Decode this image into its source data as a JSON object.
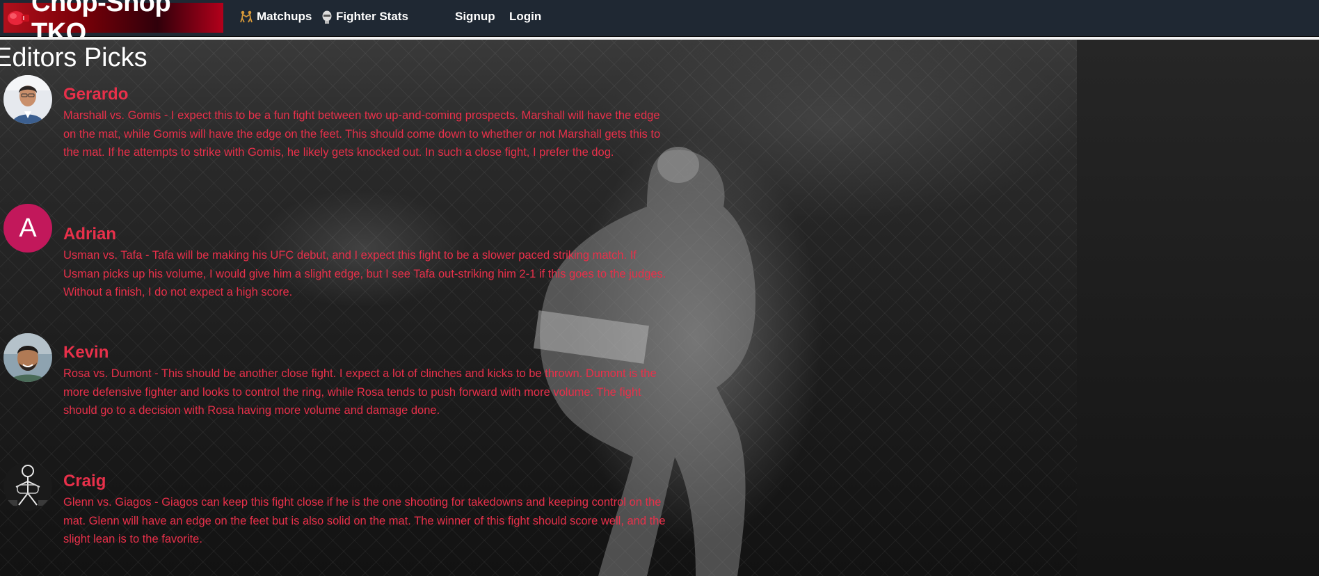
{
  "navbar": {
    "brand": "Chop-Shop TKO",
    "brand_icon": "boxing-glove-icon",
    "links": [
      {
        "label": "Matchups",
        "icon": "fighters-icon"
      },
      {
        "label": "Fighter Stats",
        "icon": "fighter-head-icon"
      },
      {
        "label": "Signup"
      },
      {
        "label": "Login"
      }
    ]
  },
  "page": {
    "title": "Editors Picks"
  },
  "picks": [
    {
      "name": "Gerardo",
      "avatar": "photo",
      "text": "Marshall vs. Gomis - I expect this to be a fun fight between two up-and-coming prospects. Marshall will have the edge on the mat, while Gomis will have the edge on the feet. This should come down to whether or not Marshall gets this to the mat. If he attempts to strike with Gomis, he likely gets knocked out. In such a close fight, I prefer the dog."
    },
    {
      "name": "Adrian",
      "avatar": "letter",
      "avatar_letter": "A",
      "text": "Usman vs. Tafa - Tafa will be making his UFC debut, and I expect this fight to be a slower paced striking match. If Usman picks up his volume, I would give him a slight edge, but I see Tafa out-striking him 2-1 if this goes to the judges. Without a finish, I do not expect a high score."
    },
    {
      "name": "Kevin",
      "avatar": "photo",
      "text": "Rosa vs. Dumont - This should be another close fight. I expect a lot of clinches and kicks to be thrown. Dumont is the more defensive fighter and looks to control the ring, while Rosa tends to push forward with more volume. The fight should go to a decision with Rosa having more volume and damage done."
    },
    {
      "name": "Craig",
      "avatar": "stick-figure",
      "text": "Glenn vs. Giagos - Giagos can keep this fight close if he is the one shooting for takedowns and keeping control on the mat. Glenn will have an edge on the feet but is also solid on the mat. The winner of this fight should score well, and the slight lean is to the favorite."
    }
  ],
  "colors": {
    "nav_bg": "#1f2833",
    "accent_text": "#e8304a",
    "avatar_letter_bg": "#c2185b"
  }
}
